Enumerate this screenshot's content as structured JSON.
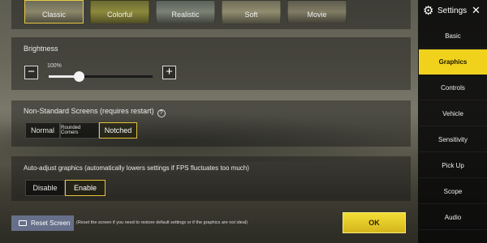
{
  "graphics_styles": [
    {
      "label": "Classic",
      "active": true
    },
    {
      "label": "Colorful",
      "active": false
    },
    {
      "label": "Realistic",
      "active": false
    },
    {
      "label": "Soft",
      "active": false
    },
    {
      "label": "Movie",
      "active": false
    }
  ],
  "brightness": {
    "label": "Brightness",
    "value_text": "100%",
    "slider_fraction": 0.29,
    "minus_icon": "minus-icon",
    "plus_icon": "plus-icon"
  },
  "screens": {
    "label": "Non-Standard Screens (requires restart)",
    "help_glyph": "?",
    "options": [
      "Normal",
      "Rounded Corners",
      "Notched"
    ],
    "selected": "Notched"
  },
  "auto_adjust": {
    "label": "Auto-adjust graphics (automatically lowers settings if FPS fluctuates too much)",
    "options": [
      "Disable",
      "Enable"
    ],
    "selected": "Enable"
  },
  "reset": {
    "label": "Reset Screen",
    "hint": "(Reset the screen if you need to restore default settings or if the graphics are not ideal)"
  },
  "ok_label": "OK",
  "sidebar": {
    "title": "Settings",
    "close_glyph": "✕",
    "gear_glyph": "⚙",
    "items": [
      {
        "label": "Basic",
        "active": false
      },
      {
        "label": "Graphics",
        "active": true
      },
      {
        "label": "Controls",
        "active": false
      },
      {
        "label": "Vehicle",
        "active": false
      },
      {
        "label": "Sensitivity",
        "active": false
      },
      {
        "label": "Pick Up",
        "active": false
      },
      {
        "label": "Scope",
        "active": false
      },
      {
        "label": "Audio",
        "active": false
      }
    ]
  },
  "colors": {
    "accent": "#f0d21c",
    "reset_button": "#66708a"
  }
}
